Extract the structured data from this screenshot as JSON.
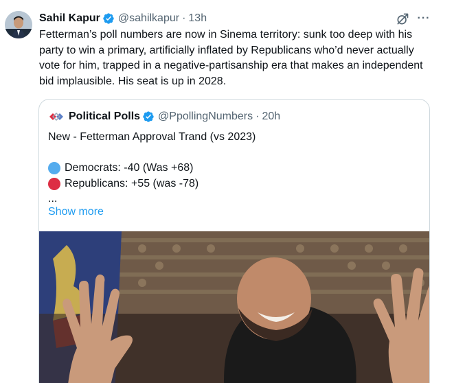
{
  "tweet": {
    "author_name": "Sahil Kapur",
    "handle": "@sahilkapur",
    "separator": "·",
    "time": "13h",
    "text": "Fetterman’s poll numbers are now in Sinema territory: sunk too deep with his party to win a primary, artificially inflated by Republicans who’d never actually vote for him, trapped in a negative-partisanship era that makes an independent bid implausible. His seat is up in 2028.",
    "more_glyph": "···"
  },
  "quote": {
    "author_name": "Political Polls",
    "handle": "@PpollingNumbers",
    "separator": "·",
    "time": "20h",
    "lines": [
      "New - Fetterman Approval Trand (vs 2023)",
      "Democrats: -40 (Was +68)",
      "Republicans: +55 (was -78)",
      "..."
    ],
    "show_more": "Show more",
    "media_alt": "photo"
  },
  "colors": {
    "verified": "#1d9bf0",
    "democrats_circle": "#55acee",
    "republicans_circle": "#dd2e44",
    "link": "#1d9bf0",
    "secondary_text": "#536471"
  },
  "icons": {
    "verified": "verified-badge-icon",
    "grok": "grok-icon",
    "more": "more-icon",
    "poll_logo": "political-polls-logo"
  }
}
